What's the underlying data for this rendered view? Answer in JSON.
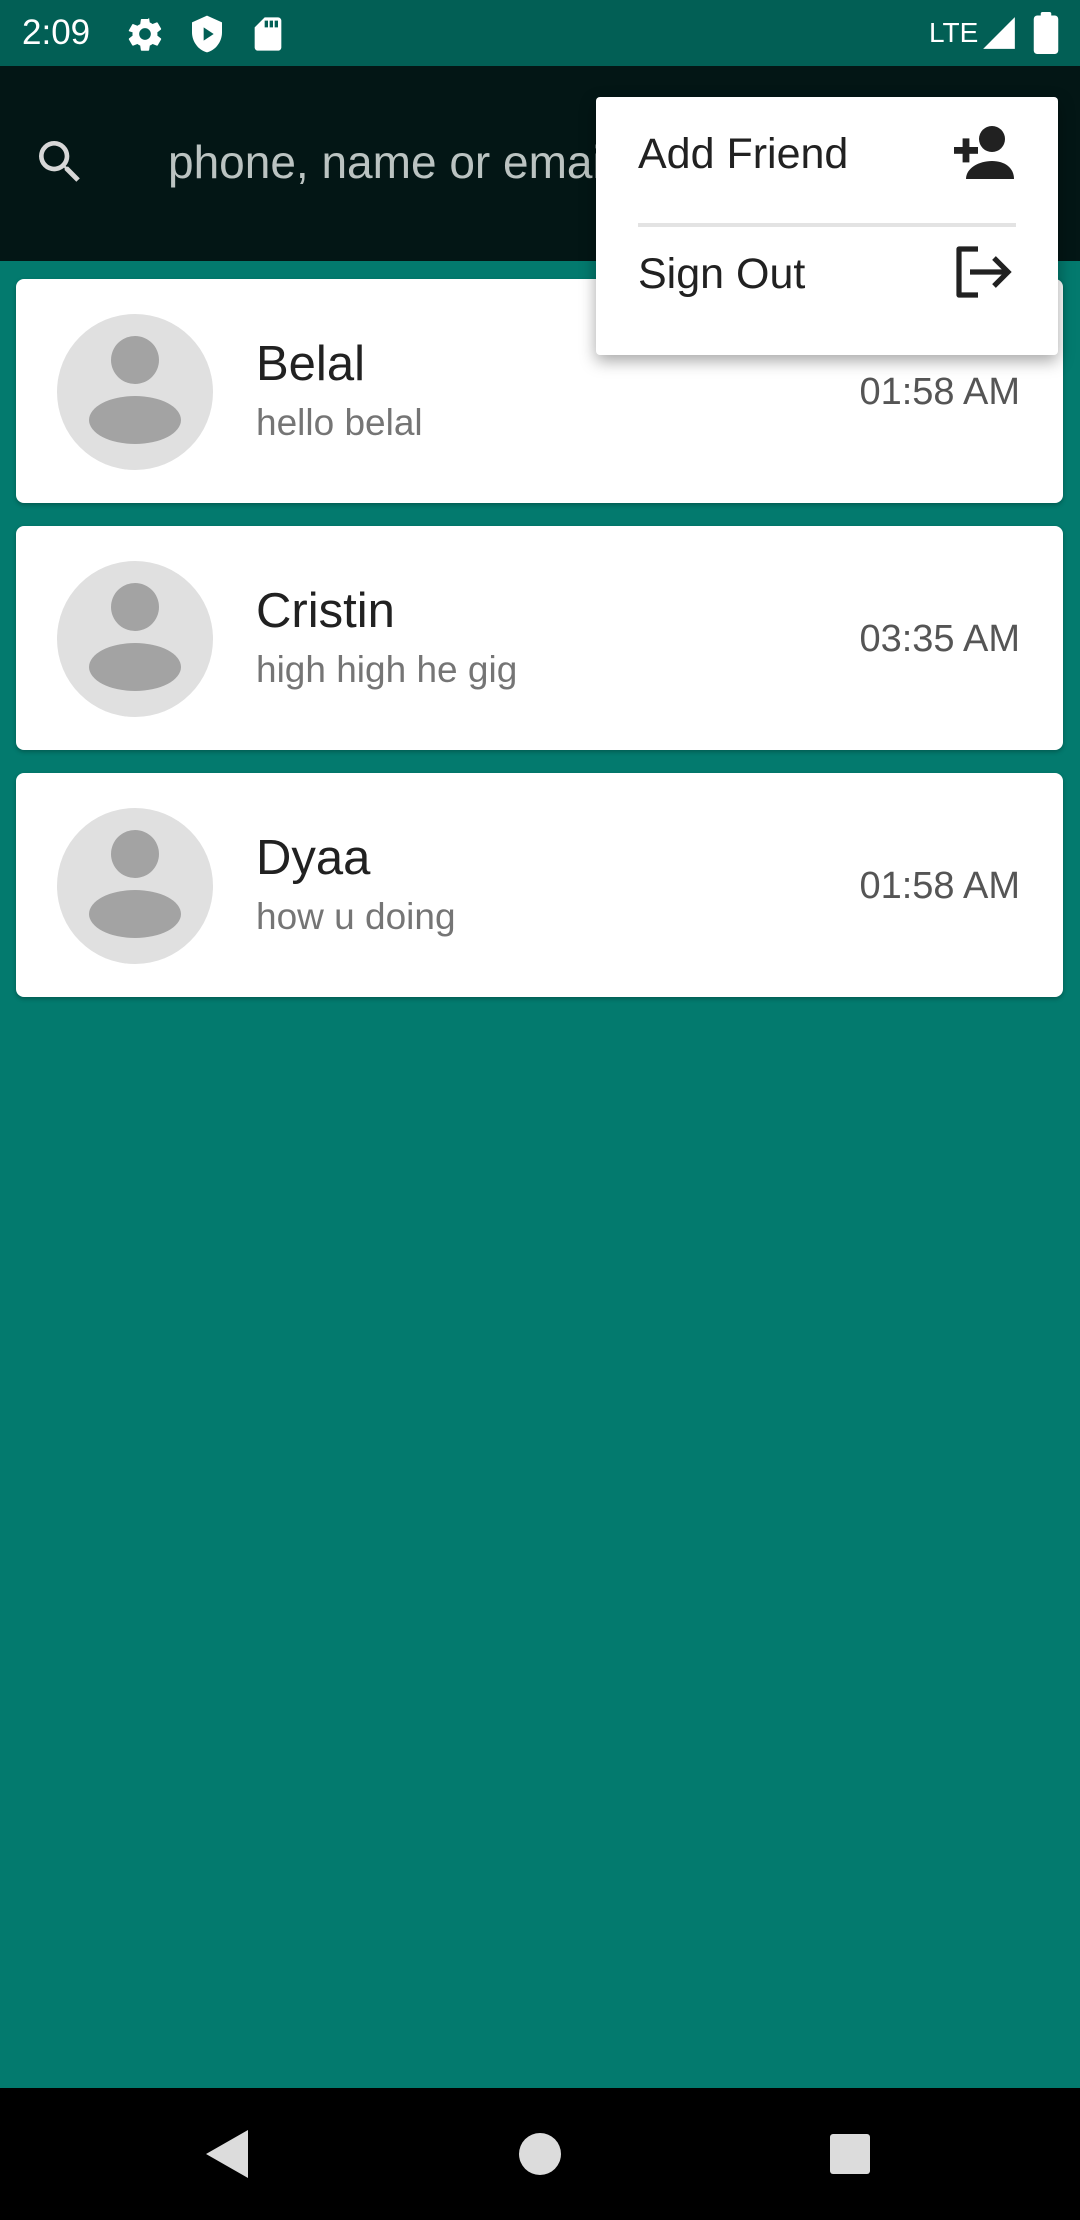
{
  "status_bar": {
    "time": "2:09",
    "network": "LTE",
    "icons": [
      "gear-icon",
      "shield-play-icon",
      "sd-card-icon",
      "signal-icon",
      "battery-icon"
    ]
  },
  "search": {
    "placeholder": "phone, name or email",
    "icon": "search-icon"
  },
  "chats": [
    {
      "name": "Belal",
      "last_message": "hello belal",
      "time": "01:58 AM"
    },
    {
      "name": "Cristin",
      "last_message": "high high he gig",
      "time": "03:35 AM"
    },
    {
      "name": "Dyaa",
      "last_message": "how u doing",
      "time": "01:58 AM"
    }
  ],
  "menu": {
    "add_friend": {
      "label": "Add Friend",
      "icon": "person-add-icon"
    },
    "sign_out": {
      "label": "Sign Out",
      "icon": "logout-icon"
    }
  },
  "nav": [
    "back-icon",
    "home-icon",
    "recents-icon"
  ],
  "colors": {
    "status_bar": "#025f55",
    "app_bar": "#031615",
    "background": "#037a6e",
    "card": "#ffffff",
    "nav_bar": "#000000"
  }
}
